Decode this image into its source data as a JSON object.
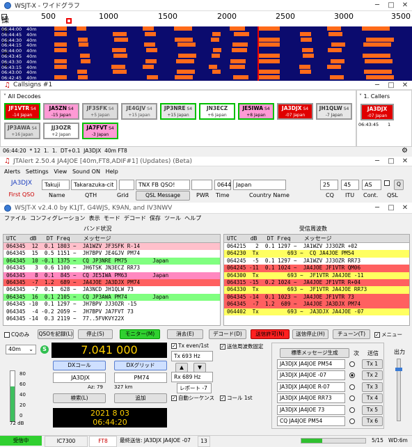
{
  "wide": {
    "title": "WSJT-X - ワイドグラフ",
    "ctrl_label": "操作パネル",
    "scale": [
      "500",
      "1000",
      "1500",
      "2000",
      "2500",
      "3000",
      "3500"
    ],
    "rows": [
      {
        "l": "06:44:00",
        "r": "40m"
      },
      {
        "l": "06:44:45",
        "r": "40m"
      },
      {
        "l": "06:44:30",
        "r": "40m"
      },
      {
        "l": "06:44:15",
        "r": "40m"
      },
      {
        "l": "06:44:00",
        "r": "40m"
      },
      {
        "l": "06:43:45",
        "r": "40m"
      },
      {
        "l": "06:43:30",
        "r": "40m"
      },
      {
        "l": "06:43:15",
        "r": "40m"
      },
      {
        "l": "06:43:00",
        "r": "40m"
      },
      {
        "l": "06:42:45",
        "r": "40m"
      }
    ]
  },
  "callsigns": {
    "title": "Callsigns #1",
    "tree_label": "All Decodes",
    "callers_label": "1. Callers",
    "items": [
      {
        "call": "JF1VTR",
        "s": "S4",
        "sub": "-14 Japan",
        "bg": "#e00000",
        "fg": "#fff",
        "border": "#00c000"
      },
      {
        "call": "JA5ZN",
        "s": "S4",
        "sub": "-15 Japan",
        "bg": "#ff9ad5",
        "fg": "#000",
        "border": "#999"
      },
      {
        "call": "JF3SFK",
        "s": "S4",
        "sub": "+5 Japan",
        "bg": "#dcdcdc",
        "fg": "#555",
        "border": "#999"
      },
      {
        "call": "JE4GJV",
        "s": "S4",
        "sub": "+15 Japan",
        "bg": "#e6e6e6",
        "fg": "#555",
        "border": "#999"
      },
      {
        "call": "JP3NRE",
        "s": "S4",
        "sub": "+15 Japan",
        "bg": "#e6e6e6",
        "fg": "#333",
        "border": "#00c000"
      },
      {
        "call": "JN3ECZ",
        "s": "",
        "sub": "+6 Japan",
        "bg": "#fff",
        "fg": "#333",
        "border": "#00c000"
      },
      {
        "call": "JE5IWA",
        "s": "S4",
        "sub": "+8 Japan",
        "bg": "#ff9ad5",
        "fg": "#000",
        "border": "#00c000"
      },
      {
        "call": "JA3DJX",
        "s": "S4",
        "sub": "-07 Japan",
        "bg": "#e00000",
        "fg": "#fff",
        "border": "#999"
      },
      {
        "call": "JH1QLW",
        "s": "S4",
        "sub": "-7 Japan",
        "bg": "#e6e6e6",
        "fg": "#333",
        "border": "#999"
      },
      {
        "call": "JP3AWA",
        "s": "S4",
        "sub": "+16 Japan",
        "bg": "#dcdcdc",
        "fg": "#555",
        "border": "#999"
      },
      {
        "call": "JJ3OZR",
        "s": "",
        "sub": "+2 Japan",
        "bg": "#fff",
        "fg": "#333",
        "border": "#999"
      },
      {
        "call": "JA7FVT",
        "s": "S4",
        "sub": "-3 Japan",
        "bg": "#ff9ad5",
        "fg": "#000",
        "border": "#00c000"
      }
    ],
    "caller": {
      "call": "JA3DJX",
      "sub": "-07 Japan",
      "time": "06:43:45",
      "count": "1"
    },
    "status": {
      "time": "06:44:20",
      "count": "* 12",
      "a": "1.",
      "b": "1.",
      "dt": "DT+0.1",
      "call": "JA3DJX",
      "band": "40m FT8"
    }
  },
  "jtalert": {
    "title": "JTAlert 2.50.4 JA4JOE [40m,FT8,ADIF#1] (Updates) (Beta)",
    "menu": [
      "Alerts",
      "Settings",
      "View",
      "Sound ON",
      "Help"
    ],
    "call": "JA3DJX",
    "name": "Takuji",
    "qth": "Takarazuka-cit",
    "grid": "",
    "msg": "TNX FB QSO!",
    "pwr": "",
    "time": "0644",
    "country": "Japan",
    "cq": "25",
    "itu": "45",
    "cont": "AS",
    "labels": {
      "first": "First QSO",
      "name": "Name",
      "qth": "QTH",
      "grid": "Grid",
      "qslmsg": "QSL Message",
      "pwr": "PWR",
      "time": "Time",
      "country": "Country Name",
      "cq": "CQ",
      "itu": "ITU",
      "cont": "Cont.",
      "qsl": "QSL"
    }
  },
  "wsjtx": {
    "title": "WSJT-X   v2.4.0   by K1JT, G4WJS, K9AN, and IV3NWV",
    "menu": [
      "ファイル",
      "コンフィグレーション",
      "表示",
      "モード",
      "デコード",
      "保存",
      "ツール",
      "ヘルプ"
    ],
    "band_title": "バンド状況",
    "rx_title": "受信周波数",
    "hdr": "UTC    dB   DT Freq    メッセージ",
    "band_rows": [
      {
        "t": "064345  12  0.1 1803 ~  JA1WZV JF3SFK R-14",
        "bg": "#ffc0cb"
      },
      {
        "t": "064345  15  0.5 1151 ~  JH7BPV JE4GJV PM74",
        "bg": "#fff"
      },
      {
        "t": "064345  10 -0.1 1375 ~  CQ JP3NRE PM75        Japan",
        "bg": "#80ff80"
      },
      {
        "t": "064345   3  0.6 1100 ~  JH6TSK JN3ECZ RR73",
        "bg": "#fff"
      },
      {
        "t": "064345   8  0.1  845 ~  CQ JE5IWA PM63        Japan",
        "bg": "#ff88c0"
      },
      {
        "t": "064345  -7  1.2  689 ~  JA4JOE JA3DJX PM74",
        "bg": "#ff6060"
      },
      {
        "t": "064345  -7  0.1  628 ~  JA3NCD JH1QLW 73",
        "bg": "#fff"
      },
      {
        "t": "064345  16  0.1 2105 ~  CQ JP3AWA PM74        Japan",
        "bg": "#80ff80"
      },
      {
        "t": "064345 -10  0.1 1297 ~  JH7BPV JJ3OZR -15",
        "bg": "#fff"
      },
      {
        "t": "064345  -4 -0.2 2059 ~  JH7BPV JA7FVT 73",
        "bg": "#fff"
      },
      {
        "t": "064345 -14  0.3 2119 ~  77..5FVKVY22X",
        "bg": "#fff"
      }
    ],
    "rx_rows": [
      {
        "t": "064215   2  0.1 1297 ~  JA1WZV JJ3OZR +02",
        "bg": "#fff"
      },
      {
        "t": "064230  Tx         693 ~  CQ JA4JOE PM54",
        "bg": "#ffff60"
      },
      {
        "t": "064245  -5  0.1 1297 ~  JA1WZV JJ3OZR RR73",
        "bg": "#fff"
      },
      {
        "t": "064245 -11  0.1 1024 ~  JA4JOE JF1VTR QM06",
        "bg": "#ff6060"
      },
      {
        "t": "064300  Tx         693 ~  JF1VTR JA4JOE -11",
        "bg": "#ffff60"
      },
      {
        "t": "064315 -15  0.2 1024 ~  JA4JOE JF1VTR R+04",
        "bg": "#ff6060"
      },
      {
        "t": "064330  Tx         693 ~  JF1VTR JA4JOE RR73",
        "bg": "#ffff60"
      },
      {
        "t": "064345 -14  0.1 1023 ~  JA4JOE JF1VTR 73",
        "bg": "#ff6060"
      },
      {
        "t": "064345  -7  1.2  689 ~  JA4JOE JA3DJX PM74",
        "bg": "#ff6060"
      },
      {
        "t": "064402  Tx         693 ~  JA3DJX JA4JOE -07",
        "bg": "#ffff60"
      }
    ],
    "buttons": {
      "cq_only": "CQのみ",
      "log": "QSOを記録(L)",
      "stop": "停止(S)",
      "monitor": "モニター(M)",
      "erase": "消去(E)",
      "decode": "デコード(D)",
      "tx_enable": "送信許可(N)",
      "tx_halt": "送信停止(H)",
      "tune": "チューン(T)",
      "menus": "メニュー"
    },
    "band": "40m",
    "freq": "7.041 000",
    "dx_call_btn": "DXコール",
    "dx_grid_btn": "DXグリッド",
    "dx_call": "JA3DJX",
    "dx_grid": "PM74",
    "az": "Az: 79",
    "km": "327 km",
    "lookup": "検索(L)",
    "add": "追加",
    "date": "2021 8 03",
    "time": "06:44:20",
    "db": "72 dB",
    "tx_even": "Tx even/1st",
    "hold": "送信周波数固定",
    "tx_hz": "Tx  693  Hz",
    "rx_hz": "Rx  689  Hz",
    "report": "レポート -7",
    "auto_seq": "自動シーケンス",
    "call_1st": "コール 1st",
    "gen_msgs": "標準メッセージ生成",
    "next": "次",
    "now": "送信",
    "power": "出力",
    "tx_msgs": [
      "JA3DJX JA4JOE PM54",
      "JA3DJX JA4JOE -07",
      "JA3DJX JA4JOE R-07",
      "JA3DJX JA4JOE RR73",
      "JA3DJX JA4JOE 73",
      "CQ JA4JOE PM54"
    ],
    "tx_btns": [
      "Tx 1",
      "Tx 2",
      "Tx 3",
      "Tx 4",
      "Tx 5",
      "Tx 6"
    ],
    "scale_ticks": [
      "80",
      "60",
      "40",
      "20",
      "0"
    ],
    "status": {
      "rx": "受信中",
      "rig": "IC7300",
      "mode": "FT8",
      "last": "最終送信: JA3DJX JA4JOE -07",
      "n": "13",
      "pages": "5/15",
      "wd": "WD:6m"
    }
  }
}
